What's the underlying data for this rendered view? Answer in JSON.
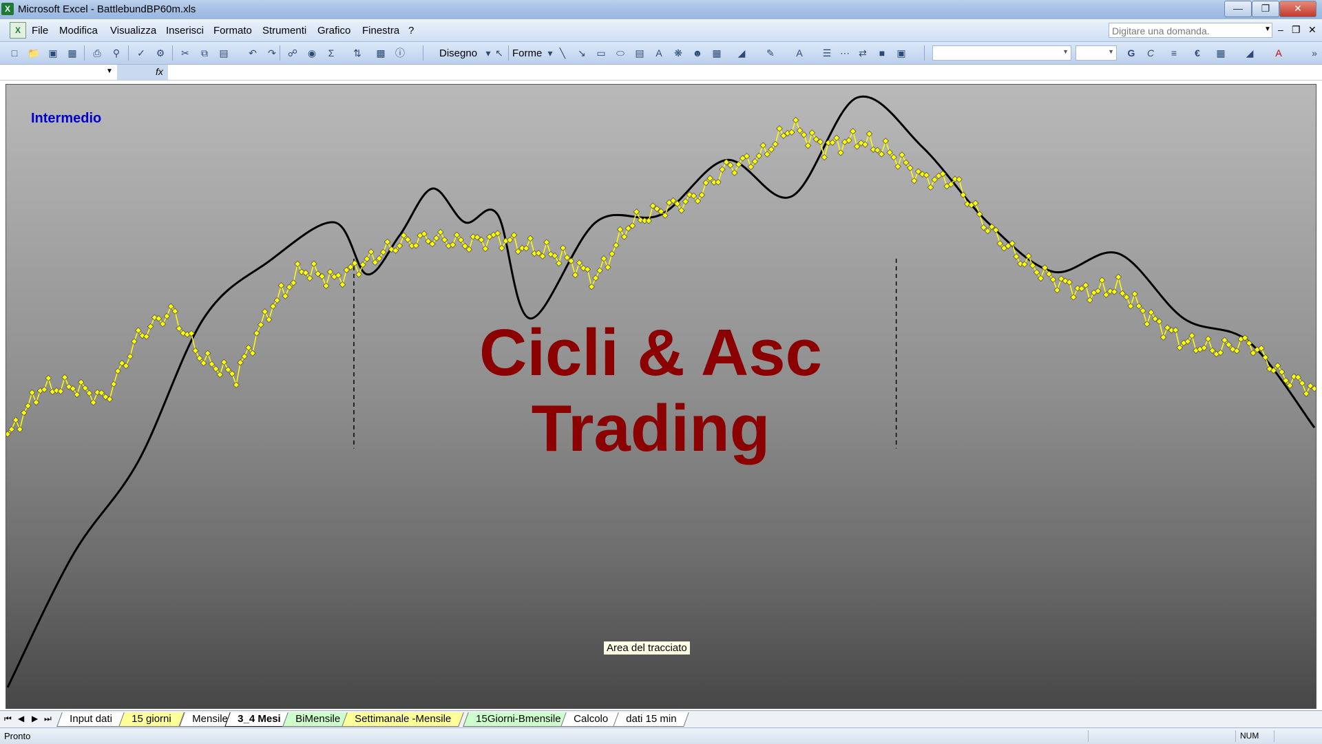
{
  "window": {
    "title": "Microsoft Excel - BattlebundBP60m.xls",
    "app_icon": "excel-icon",
    "controls": [
      "minimize-icon",
      "restore-icon",
      "close-icon"
    ]
  },
  "menubar": {
    "items": [
      "File",
      "Modifica",
      "Visualizza",
      "Inserisci",
      "Formato",
      "Strumenti",
      "Grafico",
      "Finestra",
      "?"
    ],
    "ask_placeholder": "Digitare una domanda."
  },
  "toolbar": {
    "disegno_label": "Disegno",
    "forme_label": "Forme",
    "font_combo": "",
    "size_combo": ""
  },
  "formula_bar": {
    "name_box": "",
    "fx_label": "fx",
    "formula": ""
  },
  "chart": {
    "label": "Intermedio",
    "watermark_line1": "Cicli & Asc",
    "watermark_line2": "Trading",
    "tooltip": "Area del tracciato",
    "colors": {
      "price": "#ffff00",
      "cycle": "#000000",
      "watermark": "#8b0000",
      "label": "#0000d0"
    }
  },
  "chart_data": {
    "type": "line",
    "series": [
      {
        "style": "yellow markers",
        "x": [
          0,
          5,
          10,
          15,
          20,
          25,
          30,
          35,
          40,
          45,
          50,
          55,
          60,
          65,
          70,
          75,
          80,
          85,
          90,
          95,
          100,
          105,
          110,
          115,
          120,
          125,
          130,
          135,
          140,
          145,
          150,
          155,
          160,
          165,
          170,
          175,
          180,
          185,
          190,
          195,
          200
        ],
        "values": [
          0.09,
          0.28,
          0.29,
          0.24,
          0.48,
          0.58,
          0.39,
          0.33,
          0.58,
          0.74,
          0.7,
          0.77,
          0.84,
          0.86,
          0.84,
          0.86,
          0.82,
          0.79,
          0.7,
          0.91,
          0.97,
          1.01,
          1.13,
          1.17,
          1.29,
          1.21,
          1.24,
          1.19,
          1.09,
          1.08,
          0.9,
          0.78,
          0.7,
          0.65,
          0.67,
          0.55,
          0.46,
          0.43,
          0.46,
          0.33,
          0.28
        ]
      },
      {
        "style": "black smooth line",
        "x": [
          0,
          10,
          20,
          30,
          40,
          50,
          55,
          60,
          65,
          70,
          75,
          80,
          90,
          100,
          110,
          120,
          130,
          140,
          150,
          160,
          170,
          180,
          190,
          200
        ],
        "values": [
          -0.87,
          -0.36,
          0.0,
          0.55,
          0.77,
          0.92,
          0.72,
          0.87,
          1.05,
          0.92,
          0.95,
          0.55,
          0.92,
          0.95,
          1.16,
          1.02,
          1.4,
          1.21,
          0.92,
          0.73,
          0.8,
          0.55,
          0.46,
          0.13
        ]
      }
    ],
    "vertical_markers": [
      {
        "x": 53
      },
      {
        "x": 136
      }
    ],
    "grid": false,
    "legend": "none"
  },
  "sheet_tabs": [
    {
      "label": "Input dati",
      "color": "#ffffff"
    },
    {
      "label": "15 giorni",
      "color": "#ffff99"
    },
    {
      "label": "Mensile",
      "color": "#ffffff"
    },
    {
      "label": "3_4 Mesi",
      "color": "#ffffff",
      "active": true
    },
    {
      "label": "BiMensile",
      "color": "#ccffcc"
    },
    {
      "label": "Settimanale -Mensile",
      "color": "#ffff99"
    },
    {
      "label": "15Giorni-Bmensile",
      "color": "#ccffcc"
    },
    {
      "label": "Calcolo",
      "color": "#ffffff"
    },
    {
      "label": "dati 15 min",
      "color": "#ffffff"
    }
  ],
  "status": {
    "ready": "Pronto",
    "num": "NUM"
  }
}
